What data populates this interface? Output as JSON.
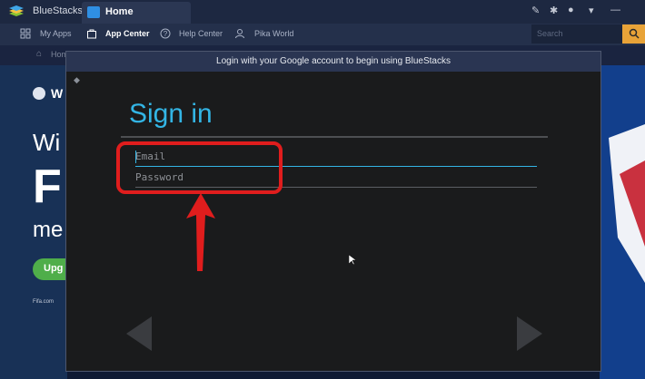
{
  "titlebar": {
    "app_name": "BlueStacks",
    "tab_label": "Home",
    "controls": [
      "pin-icon",
      "settings-icon",
      "record-icon",
      "menu-icon",
      "minimize-icon"
    ]
  },
  "nav": {
    "items": [
      {
        "label": "My Apps",
        "icon": "grid-icon"
      },
      {
        "label": "App Center",
        "icon": "bag-icon",
        "active": true
      },
      {
        "label": "Help Center",
        "icon": "help-icon"
      },
      {
        "label": "Pika World",
        "icon": "user-icon"
      }
    ],
    "search_placeholder": "Search"
  },
  "breadcrumb": {
    "label": "Hom"
  },
  "background": {
    "w1": "W",
    "w2": "Wi",
    "f": "F",
    "me": "me",
    "upgrade": "Upg",
    "fifa": "Fifa.com"
  },
  "dialog": {
    "message": "Login with your Google account to begin using BlueStacks",
    "title": "Sign in",
    "email_value": "Email",
    "password_value": "Password"
  },
  "colors": {
    "accent": "#33b5e5",
    "highlight": "#e01d1d",
    "header": "#2a3552",
    "search_button": "#e8a338"
  }
}
